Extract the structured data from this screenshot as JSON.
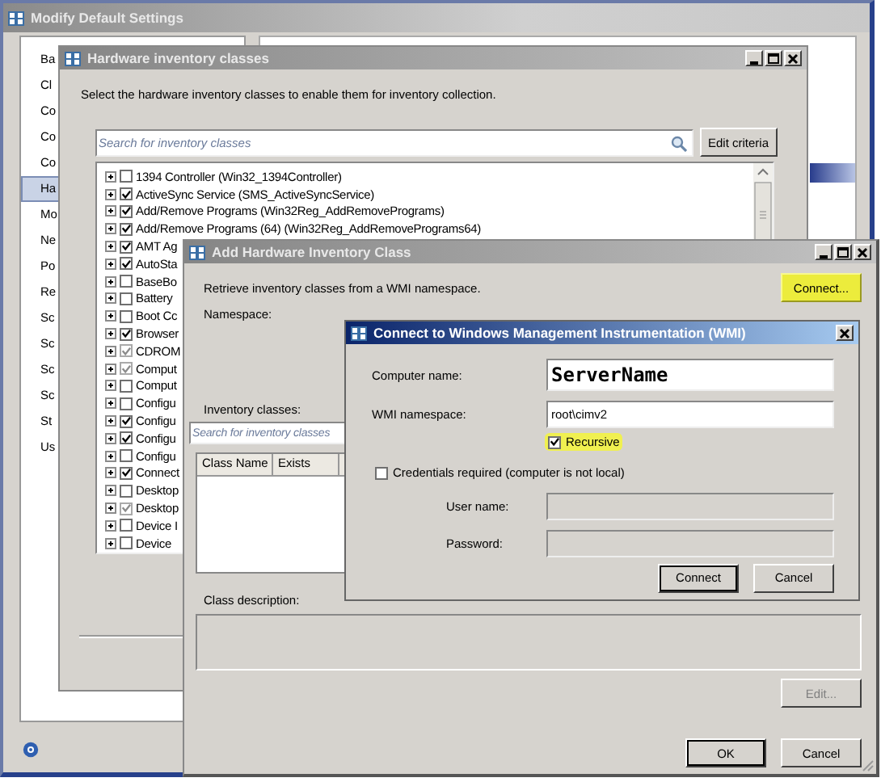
{
  "main_window": {
    "title": "Modify Default Settings",
    "sidebar": {
      "items": [
        {
          "label": "Ba",
          "selected": false
        },
        {
          "label": "Cl",
          "selected": false
        },
        {
          "label": "Co",
          "selected": false
        },
        {
          "label": "Co",
          "selected": false
        },
        {
          "label": "Co",
          "selected": false
        },
        {
          "label": "Ha",
          "selected": true
        },
        {
          "label": "Mo",
          "selected": false
        },
        {
          "label": "Ne",
          "selected": false
        },
        {
          "label": "Po",
          "selected": false
        },
        {
          "label": "Re",
          "selected": false
        },
        {
          "label": "Sc",
          "selected": false
        },
        {
          "label": "Sc",
          "selected": false
        },
        {
          "label": "Sc",
          "selected": false
        },
        {
          "label": "Sc",
          "selected": false
        },
        {
          "label": "St",
          "selected": false
        },
        {
          "label": "Us",
          "selected": false
        }
      ]
    }
  },
  "hardware_window": {
    "title": "Hardware inventory classes",
    "instruction": "Select the hardware inventory classes to enable them for inventory collection.",
    "search": {
      "placeholder": "Search for inventory classes"
    },
    "edit_criteria_button": "Edit criteria",
    "classes": [
      {
        "label": "1394 Controller (Win32_1394Controller)",
        "checked": false,
        "disabled": false
      },
      {
        "label": "ActiveSync Service (SMS_ActiveSyncService)",
        "checked": true,
        "disabled": false
      },
      {
        "label": "Add/Remove Programs (Win32Reg_AddRemovePrograms)",
        "checked": true,
        "disabled": false
      },
      {
        "label": "Add/Remove Programs (64) (Win32Reg_AddRemovePrograms64)",
        "checked": true,
        "disabled": false
      },
      {
        "label": "AMT Ag",
        "checked": true,
        "disabled": false
      },
      {
        "label": "AutoSta",
        "checked": true,
        "disabled": false
      },
      {
        "label": "BaseBo",
        "checked": false,
        "disabled": false
      },
      {
        "label": "Battery",
        "checked": false,
        "disabled": false
      },
      {
        "label": "Boot Cc",
        "checked": false,
        "disabled": false
      },
      {
        "label": "Browser",
        "checked": true,
        "disabled": false
      },
      {
        "label": "CDROM",
        "checked": true,
        "disabled": true
      },
      {
        "label": "Comput",
        "checked": true,
        "disabled": true
      },
      {
        "label": "Comput",
        "checked": false,
        "disabled": false
      },
      {
        "label": "Configu",
        "checked": false,
        "disabled": false
      },
      {
        "label": "Configu",
        "checked": true,
        "disabled": false
      },
      {
        "label": "Configu",
        "checked": true,
        "disabled": false
      },
      {
        "label": "Configu",
        "checked": false,
        "disabled": false
      },
      {
        "label": "Connect",
        "checked": true,
        "disabled": false
      },
      {
        "label": "Desktop",
        "checked": false,
        "disabled": false
      },
      {
        "label": "Desktop",
        "checked": true,
        "disabled": true
      },
      {
        "label": "Device I",
        "checked": false,
        "disabled": false
      },
      {
        "label": "Device",
        "checked": false,
        "disabled": false
      }
    ]
  },
  "add_window": {
    "title": "Add Hardware Inventory Class",
    "instruction": "Retrieve inventory classes from a WMI namespace.",
    "connect_button": {
      "label": "Connect...",
      "highlighted": true
    },
    "namespace_label": "Namespace:",
    "inventory_label": "Inventory classes:",
    "search": {
      "placeholder": "Search for inventory classes"
    },
    "columns": [
      "Class Name",
      "Exists"
    ],
    "description_label": "Class description:",
    "edit_button": {
      "label": "Edit...",
      "disabled": true
    },
    "buttons": [
      "OK",
      "Cancel"
    ]
  },
  "wmi_dialog": {
    "title": "Connect to Windows Management Instrumentation (WMI)",
    "computer_name": {
      "label": "Computer name:",
      "value": "ServerName"
    },
    "namespace": {
      "label": "WMI namespace:",
      "value": "root\\cimv2"
    },
    "recursive": {
      "label": "Recursive",
      "checked": true,
      "highlighted": true
    },
    "credentials": {
      "label": "Credentials required (computer is not local)",
      "checked": false
    },
    "user_name": {
      "label": "User name:",
      "disabled": true
    },
    "password": {
      "label": "Password:",
      "disabled": true
    },
    "buttons": [
      "Connect",
      "Cancel"
    ]
  }
}
